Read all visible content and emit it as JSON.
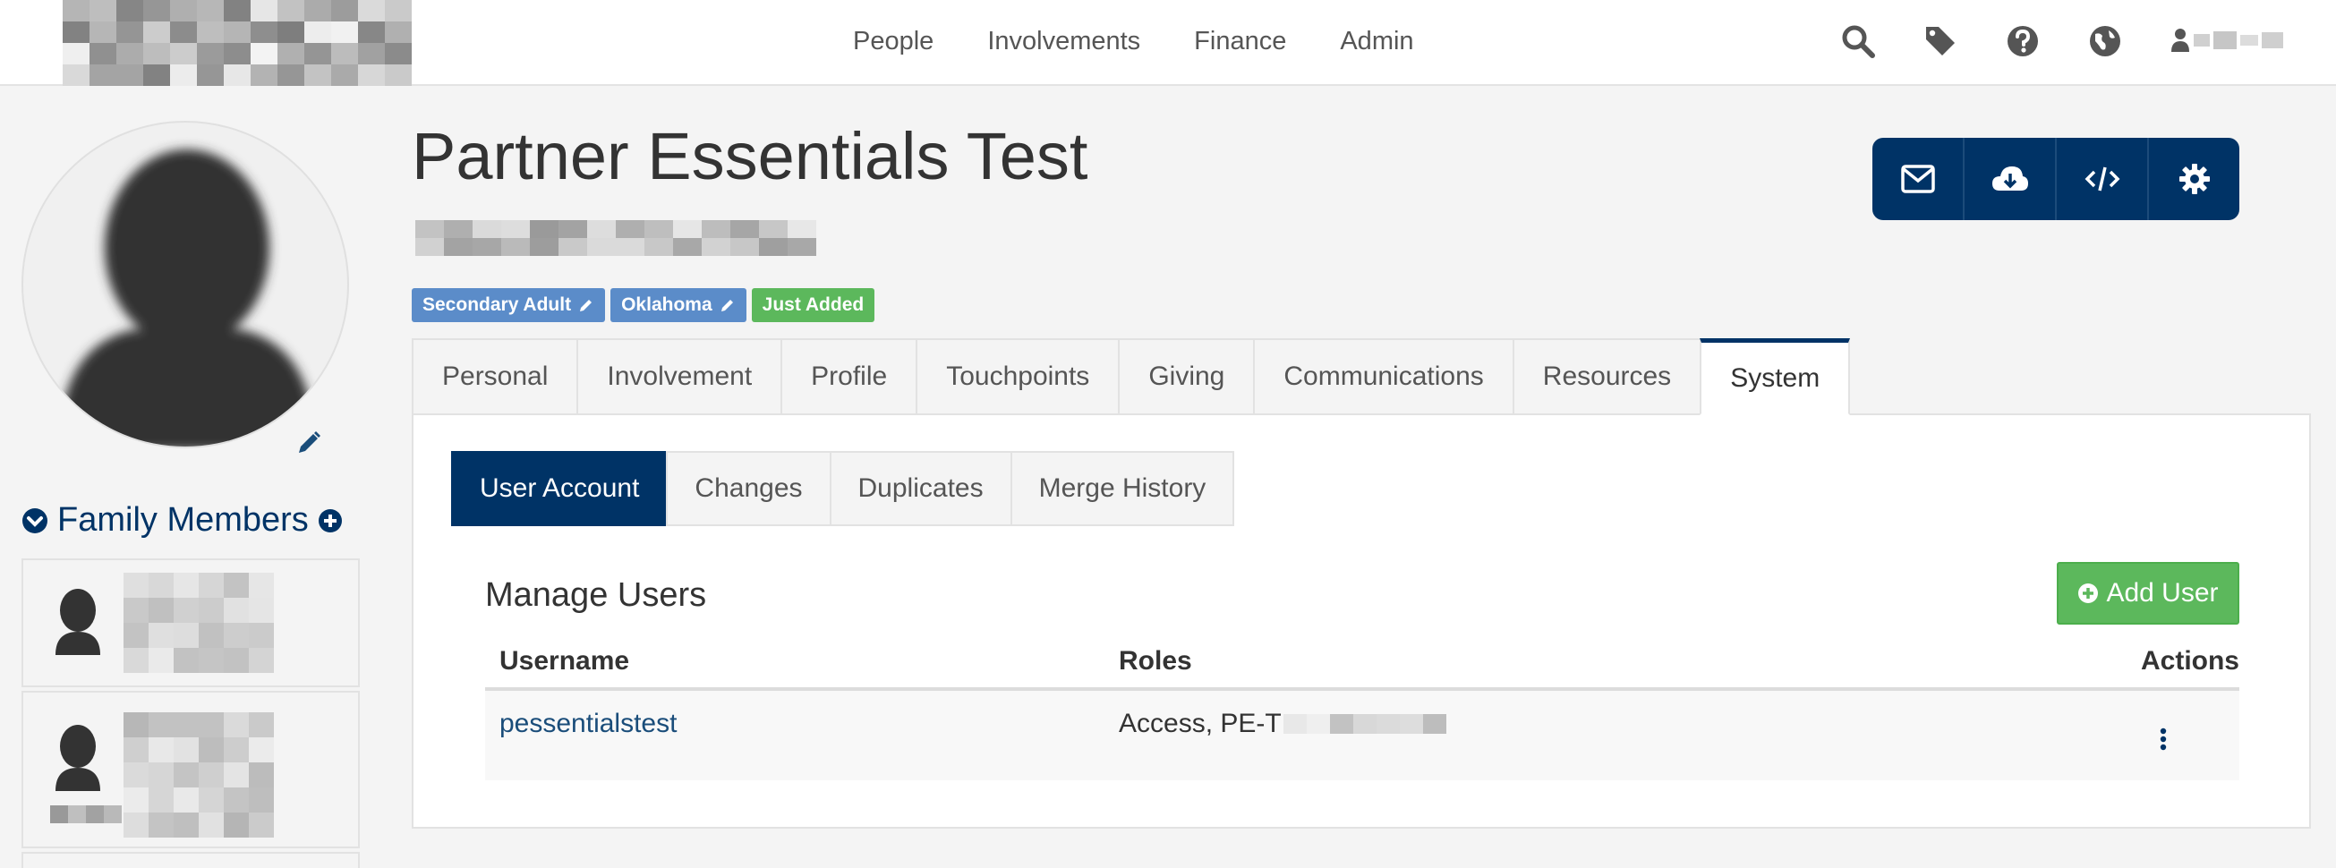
{
  "nav": {
    "items": [
      "People",
      "Involvements",
      "Finance",
      "Admin"
    ],
    "icons": [
      "search-icon",
      "tag-icon",
      "question-circle-icon",
      "globe-icon",
      "user-icon"
    ]
  },
  "profile": {
    "name": "Partner Essentials Test",
    "badges": [
      {
        "label": "Secondary Adult",
        "color": "#5b8cc9",
        "icon": "pencil-icon"
      },
      {
        "label": "Oklahoma",
        "color": "#5b8cc9",
        "icon": "pencil-icon"
      },
      {
        "label": "Just Added",
        "color": "#5cb85c"
      }
    ]
  },
  "actions": [
    "envelope-icon",
    "cloud-download-icon",
    "code-icon",
    "gear-icon"
  ],
  "family": {
    "title": "Family Members"
  },
  "tabs": [
    "Personal",
    "Involvement",
    "Profile",
    "Touchpoints",
    "Giving",
    "Communications",
    "Resources",
    "System"
  ],
  "active_tab": "System",
  "subtabs": [
    "User Account",
    "Changes",
    "Duplicates",
    "Merge History"
  ],
  "active_subtab": "User Account",
  "manage": {
    "title": "Manage Users",
    "add_button": "Add User"
  },
  "table": {
    "columns": [
      "Username",
      "Roles",
      "Actions"
    ],
    "rows": [
      {
        "username": "pessentialstest",
        "roles": "Access, PE-T"
      }
    ]
  },
  "colors": {
    "brand": "#003366",
    "success": "#5cb85c",
    "link": "#1a4d7a"
  }
}
